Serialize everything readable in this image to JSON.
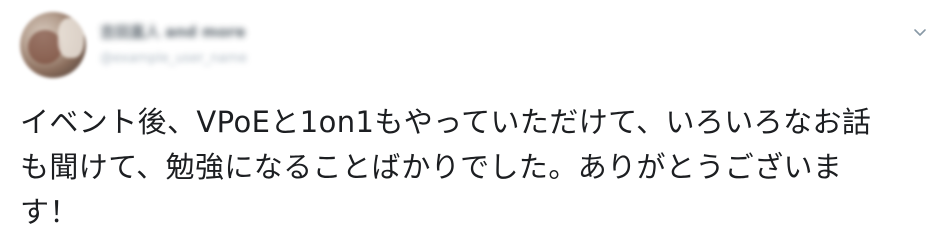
{
  "user": {
    "display_name": "吉田直人 and more",
    "screen_name": "@example_user_name"
  },
  "tweet": {
    "lines": [
      "イベント後、VPoEと1on1もやっていただけて、いろいろなお話",
      "も聞けて、勉強になることばかりでした。ありがとうございま",
      "す！"
    ]
  },
  "icons": {
    "avatar": "profile-photo",
    "chevron": "chevron-down-icon"
  },
  "colors": {
    "text": "#1c1e21",
    "muted": "#8a9aa8",
    "chevron": "#8899a6",
    "background": "#ffffff"
  }
}
